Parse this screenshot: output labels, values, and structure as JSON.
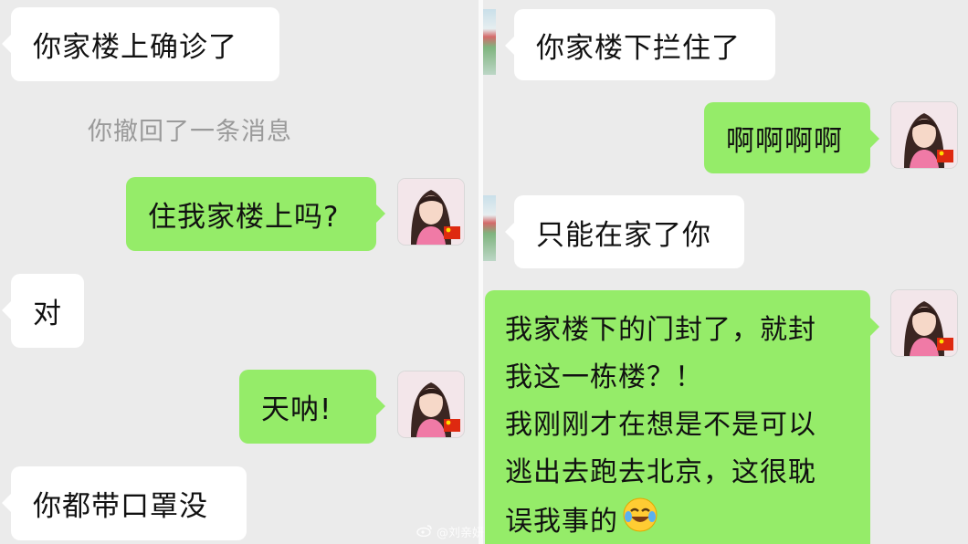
{
  "left": {
    "messages": [
      {
        "side": "incoming",
        "text": "你家楼上确诊了"
      },
      {
        "type": "recall",
        "text": "你撤回了一条消息"
      },
      {
        "side": "outgoing",
        "text": "住我家楼上吗?"
      },
      {
        "side": "incoming",
        "text": "对"
      },
      {
        "side": "outgoing",
        "text": "天呐!"
      },
      {
        "side": "incoming",
        "text": "你都带口罩没"
      }
    ]
  },
  "right": {
    "messages": [
      {
        "side": "incoming",
        "text": "你家楼下拦住了"
      },
      {
        "side": "outgoing",
        "text": "啊啊啊啊"
      },
      {
        "side": "incoming",
        "text": "只能在家了你"
      },
      {
        "side": "outgoing",
        "lines": [
          "我家楼下的门封了，就封",
          "我这一栋楼？！",
          "我刚刚才在想是不是可以",
          "逃出去跑去北京，这很耽",
          "误我事的"
        ],
        "emoji": "laughing-crying-emoji"
      }
    ]
  },
  "watermark": {
    "text": "@刘亲妍",
    "icon": "weibo-icon"
  },
  "colors": {
    "background": "#ebebeb",
    "incoming_bubble": "#ffffff",
    "outgoing_bubble": "#95ec69"
  }
}
